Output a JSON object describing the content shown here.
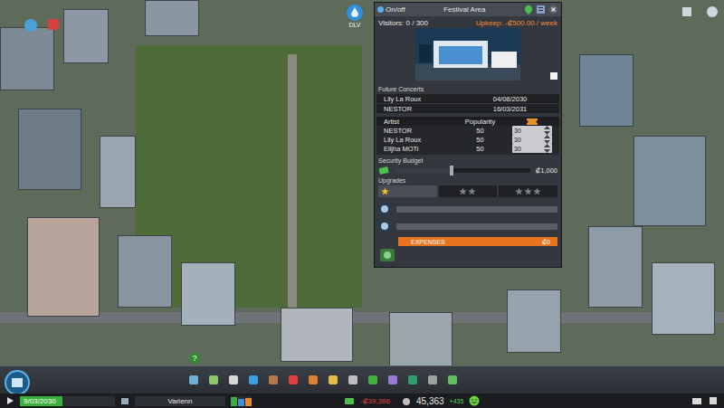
{
  "hud": {
    "top_badge": "DLV"
  },
  "panel": {
    "toggle_label": "On/off",
    "on": true,
    "title": "Festival Area",
    "visitors": "Visitors: 0 / 300",
    "upkeep": "Upkeep: -₡500.00 / week",
    "future_concerts": {
      "title": "Future Concerts",
      "rows": [
        {
          "artist": "Lily La Roux",
          "date": "04/08/2030"
        },
        {
          "artist": "NESTOR",
          "date": "16/03/2031"
        }
      ]
    },
    "artists": {
      "columns": [
        "Artist",
        "Popularity"
      ],
      "rows": [
        {
          "name": "NESTOR",
          "popularity": "50",
          "ticket": "30"
        },
        {
          "name": "Lily La Roux",
          "popularity": "50",
          "ticket": "30"
        },
        {
          "name": "Elijha MOTi",
          "popularity": "50",
          "ticket": "30"
        }
      ]
    },
    "security": {
      "title": "Security Budget",
      "level": 0.42,
      "value": "₡1,000"
    },
    "upgrades": {
      "title": "Upgrades",
      "tabs": [
        {
          "stars": 1,
          "selected": true
        },
        {
          "stars": 2,
          "selected": false
        },
        {
          "stars": 3,
          "selected": false
        }
      ],
      "slots": [
        {
          "level": 0
        },
        {
          "level": 0
        }
      ],
      "expenses_label": "EXPENSES",
      "expenses": "₡0"
    }
  },
  "bottom_bar": {
    "date": "9/03/2030",
    "day_level": 0.45,
    "city": "Varienn",
    "demand": [
      {
        "level": 0.9,
        "color": "#3fb03f"
      },
      {
        "level": 0.7,
        "color": "#3f8fd6"
      },
      {
        "level": 0.8,
        "color": "#e8872c"
      }
    ],
    "expense": "-₡39,386",
    "money": "45,363",
    "income": "+435",
    "help": "?"
  }
}
